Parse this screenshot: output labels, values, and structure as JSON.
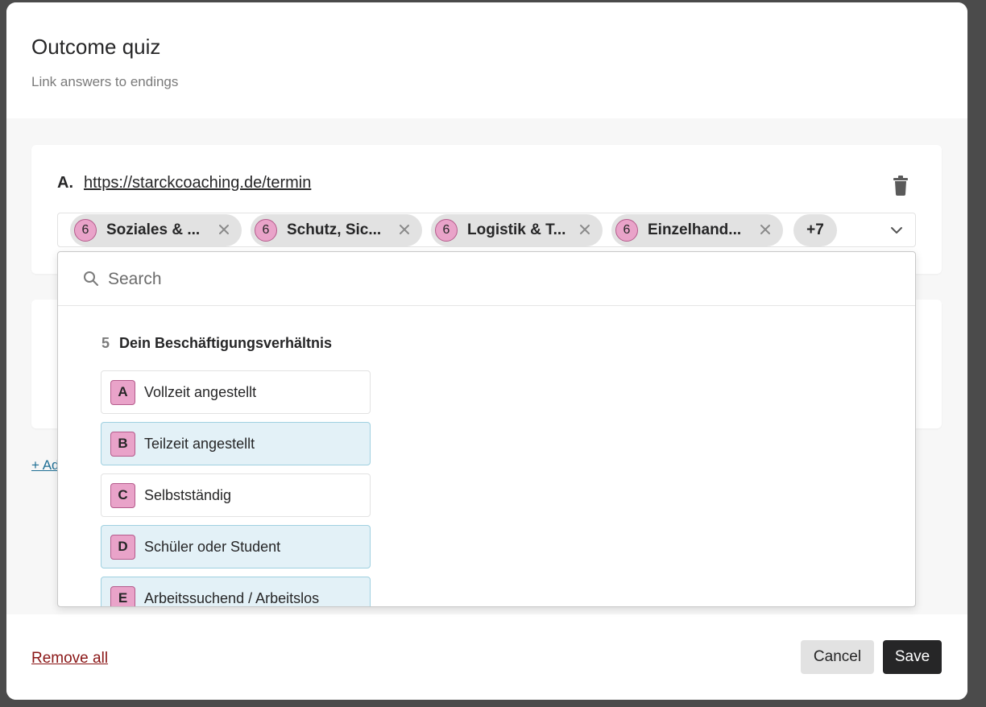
{
  "modal": {
    "title": "Outcome quiz",
    "subtitle": "Link answers to endings"
  },
  "ending": {
    "letter": "A.",
    "url": "https://starckcoaching.de/termin",
    "chips": [
      {
        "number": "6",
        "label": "Soziales & ..."
      },
      {
        "number": "6",
        "label": "Schutz, Sic..."
      },
      {
        "number": "6",
        "label": "Logistik & T..."
      },
      {
        "number": "6",
        "label": "Einzelhand..."
      }
    ],
    "more_label": "+7"
  },
  "add_link": "+ Ad",
  "dropdown": {
    "search_placeholder": "Search",
    "group_number": "5",
    "group_title": "Dein Beschäftigungsverhältnis",
    "options": [
      {
        "letter": "A",
        "label": "Vollzeit angestellt",
        "selected": false
      },
      {
        "letter": "B",
        "label": "Teilzeit angestellt",
        "selected": true
      },
      {
        "letter": "C",
        "label": "Selbstständig",
        "selected": false
      },
      {
        "letter": "D",
        "label": "Schüler oder Student",
        "selected": true
      },
      {
        "letter": "E",
        "label": "Arbeitssuchend / Arbeitslos",
        "selected": true
      }
    ]
  },
  "footer": {
    "remove_all": "Remove all",
    "cancel": "Cancel",
    "save": "Save"
  },
  "colors": {
    "backdrop": "#4b4b4b",
    "chip_badge": "#e9a3c9",
    "selected_option": "#e3f1f7",
    "remove_link": "#8a1616",
    "save_button": "#262627"
  }
}
